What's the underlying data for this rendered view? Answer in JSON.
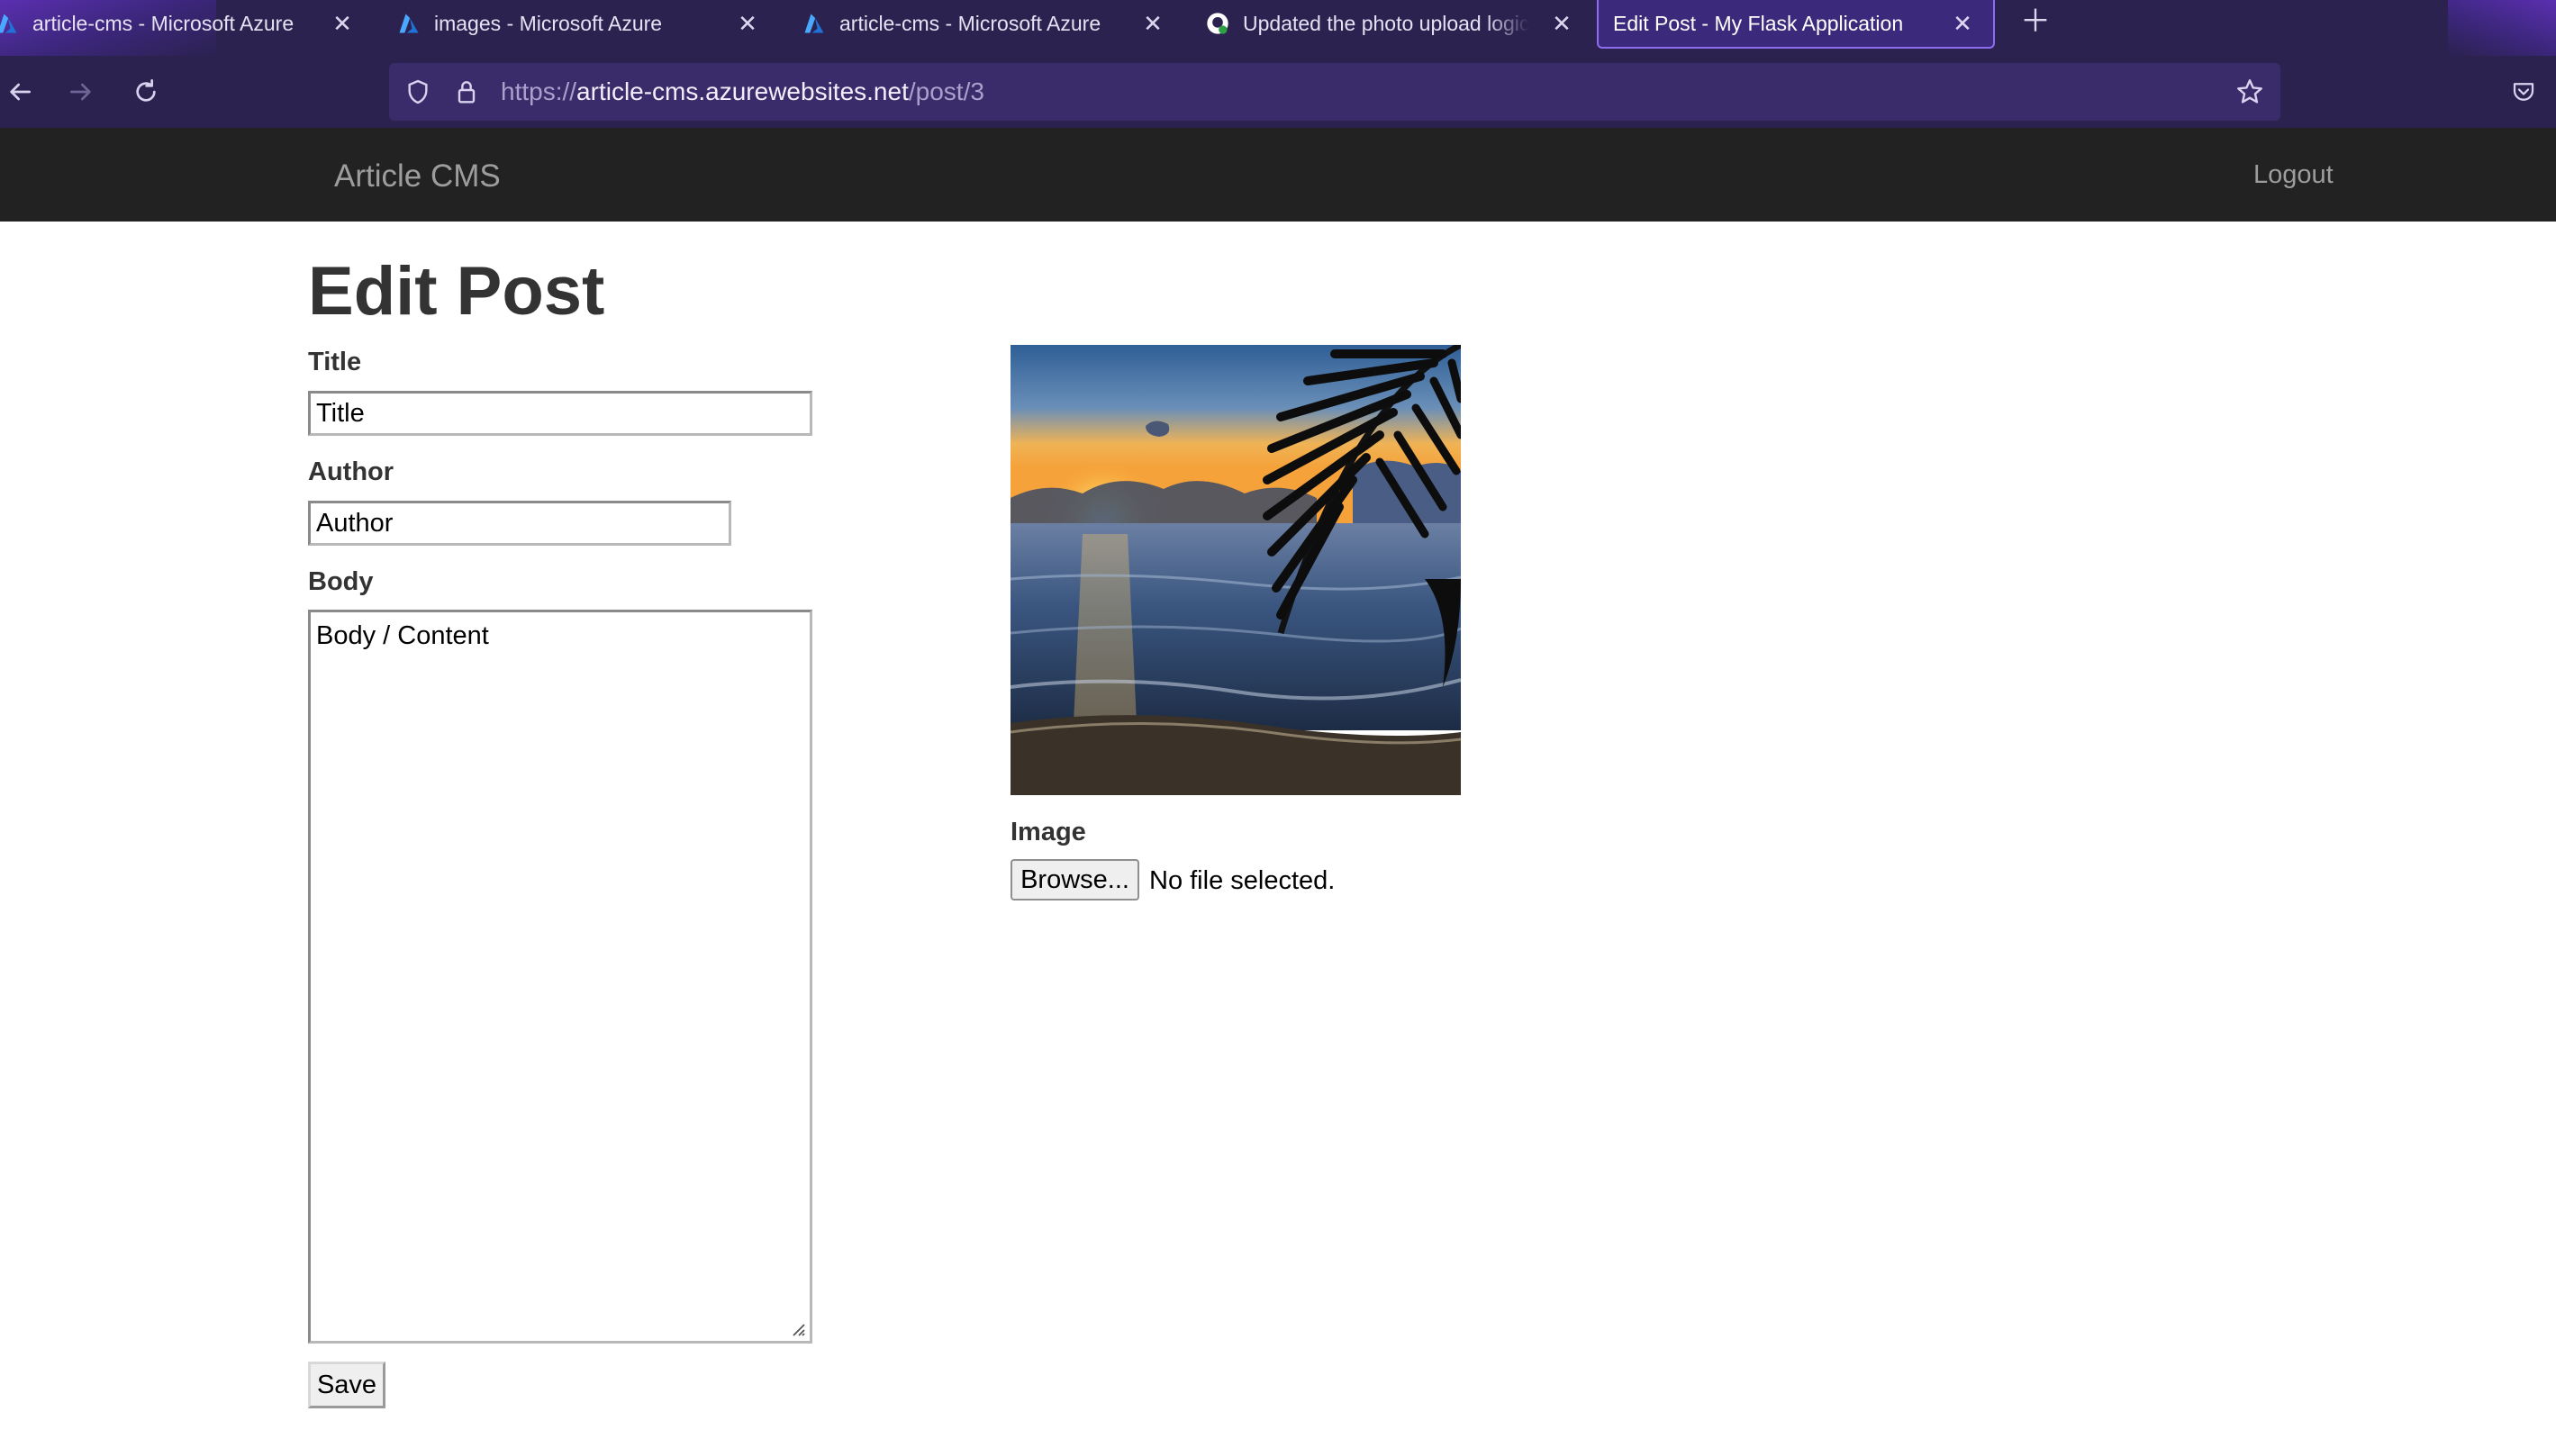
{
  "browser": {
    "tabs": [
      {
        "title": "article-cms - Microsoft Azure",
        "icon": "azure-icon"
      },
      {
        "title": "images - Microsoft Azure",
        "icon": "azure-icon"
      },
      {
        "title": "article-cms - Microsoft Azure",
        "icon": "azure-icon"
      },
      {
        "title": "Updated the photo upload logic",
        "icon": "github-icon"
      },
      {
        "title": "Edit Post - My Flask Application",
        "icon": "",
        "active": true
      }
    ],
    "url": {
      "scheme": "https://",
      "host": "article-cms.azurewebsites.net",
      "path": "/post/3"
    },
    "colors": {
      "chrome_bg": "#2b2250",
      "accent": "#8d6cf0"
    }
  },
  "site": {
    "brand": "Article CMS",
    "logout_label": "Logout",
    "header_bg": "#222222"
  },
  "page": {
    "title": "Edit Post",
    "form": {
      "title_label": "Title",
      "title_value": "Title",
      "author_label": "Author",
      "author_value": "Author",
      "body_label": "Body",
      "body_value": "Body / Content",
      "image_label": "Image",
      "browse_label": "Browse...",
      "file_status": "No file selected.",
      "save_label": "Save"
    }
  }
}
